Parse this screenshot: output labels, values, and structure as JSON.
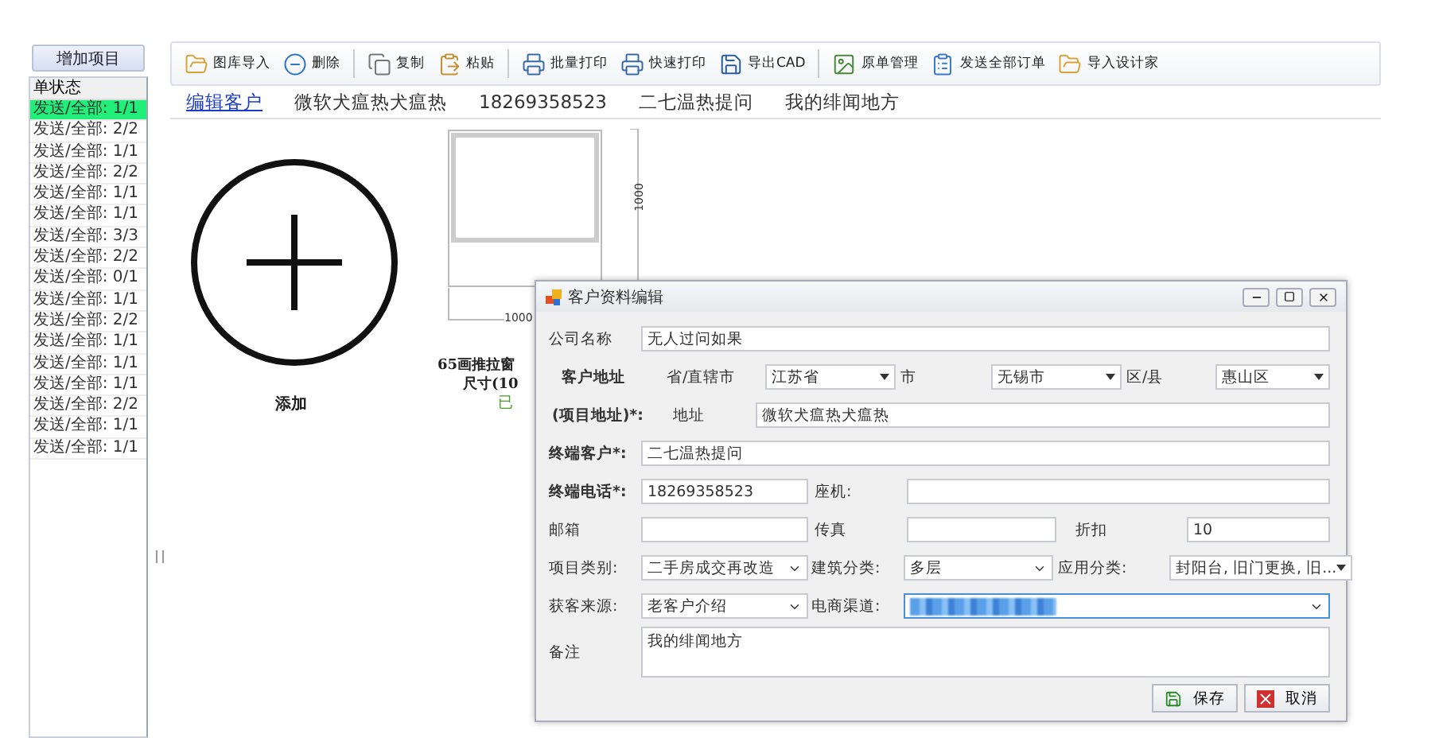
{
  "sidebar": {
    "add_button": "增加项目",
    "header": "单状态",
    "rows": [
      {
        "label": "发送/全部: 1/1",
        "selected": true
      },
      {
        "label": "发送/全部: 2/2",
        "selected": false
      },
      {
        "label": "发送/全部: 1/1",
        "selected": false
      },
      {
        "label": "发送/全部: 2/2",
        "selected": false
      },
      {
        "label": "发送/全部: 1/1",
        "selected": false
      },
      {
        "label": "发送/全部: 1/1",
        "selected": false
      },
      {
        "label": "发送/全部: 3/3",
        "selected": false
      },
      {
        "label": "发送/全部: 2/2",
        "selected": false
      },
      {
        "label": "发送/全部: 0/1",
        "selected": false
      },
      {
        "label": "发送/全部: 1/1",
        "selected": false
      },
      {
        "label": "发送/全部: 2/2",
        "selected": false
      },
      {
        "label": "发送/全部: 1/1",
        "selected": false
      },
      {
        "label": "发送/全部: 1/1",
        "selected": false
      },
      {
        "label": "发送/全部: 1/1",
        "selected": false
      },
      {
        "label": "发送/全部: 2/2",
        "selected": false
      },
      {
        "label": "发送/全部: 1/1",
        "selected": false
      },
      {
        "label": "发送/全部: 1/1",
        "selected": false
      }
    ]
  },
  "toolbar": {
    "groups": [
      [
        {
          "label": "图库导入",
          "kind": "folder"
        },
        {
          "label": "删除",
          "kind": "minus"
        }
      ],
      [
        {
          "label": "复制",
          "kind": "copy"
        },
        {
          "label": "粘贴",
          "kind": "paste"
        }
      ],
      [
        {
          "label": "批量打印",
          "kind": "print"
        },
        {
          "label": "快速打印",
          "kind": "print"
        },
        {
          "label": "导出CAD",
          "kind": "export"
        }
      ],
      [
        {
          "label": "原单管理",
          "kind": "image"
        },
        {
          "label": "发送全部订单",
          "kind": "clipboard"
        },
        {
          "label": "导入设计家",
          "kind": "folder"
        }
      ]
    ]
  },
  "customer_bar": {
    "edit_link": "编辑客户",
    "fields": [
      "微软犬瘟热犬瘟热",
      "18269358523",
      "二七温热提问",
      "我的绯闻地方"
    ]
  },
  "canvas": {
    "add_label": "添加",
    "window_item": {
      "width_dim": "1000",
      "height_dim": "1000",
      "caption_lines": [
        "65画推拉窗",
        "尺寸(10"
      ],
      "status": "已"
    }
  },
  "dialog": {
    "title": "客户资料编辑",
    "company": {
      "label": "公司名称",
      "value": "无人过问如果"
    },
    "address": {
      "label_1": "客户地址",
      "label_2": "(项目地址)*:",
      "province_label": "省/直辖市",
      "province": "江苏省",
      "city_label": "市",
      "city": "无锡市",
      "district_label": "区/县",
      "district": "惠山区",
      "street_label": "地址",
      "street": "微软犬瘟热犬瘟热"
    },
    "end_customer": {
      "label": "终端客户*:",
      "value": "二七温热提问"
    },
    "phone": {
      "label": "终端电话*:",
      "value": "18269358523"
    },
    "landline": {
      "label": "座机:"
    },
    "email": {
      "label": "邮箱"
    },
    "fax": {
      "label": "传真"
    },
    "discount": {
      "label": "折扣",
      "value": "10"
    },
    "project_type": {
      "label": "项目类别:",
      "value": "二手房成交再改造"
    },
    "building_type": {
      "label": "建筑分类:",
      "value": "多层"
    },
    "application": {
      "label": "应用分类:",
      "value": "封阳台, 旧门更换, 旧..."
    },
    "source": {
      "label": "获客来源:",
      "value": "老客户介绍"
    },
    "channel": {
      "label": "电商渠道:",
      "focused": true
    },
    "notes": {
      "label": "备注",
      "value": "我的绯闻地方"
    },
    "buttons": [
      {
        "label": "保存",
        "kind": "save"
      },
      {
        "label": "取消",
        "kind": "cancel"
      }
    ]
  }
}
